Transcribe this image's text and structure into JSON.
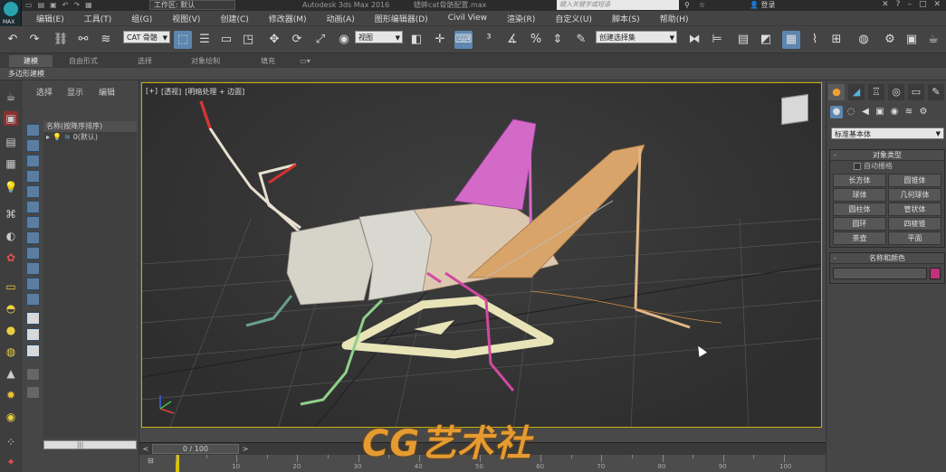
{
  "titlebar": {
    "logo_text": "MAX",
    "workspace": "工作区: 默认",
    "app_title": "Autodesk 3ds Max 2016",
    "doc_title": "蟋蟀cat骨骼配置.max",
    "search_placeholder": "键入关键字或短语",
    "login": "登录"
  },
  "menu": [
    "编辑(E)",
    "工具(T)",
    "组(G)",
    "视图(V)",
    "创建(C)",
    "修改器(M)",
    "动画(A)",
    "图形编辑器(D)",
    "Civil View",
    "渲染(R)",
    "自定义(U)",
    "脚本(S)",
    "帮助(H)"
  ],
  "toolbar": {
    "filter": "CAT 骨骼",
    "ref_coord": "视图",
    "named_selection": "创建选择集"
  },
  "ribbon": {
    "tabs": [
      "建模",
      "自由形式",
      "选择",
      "对象绘制",
      "填充"
    ],
    "subtab": "多边形建模"
  },
  "explorer": {
    "tabs": [
      "选择",
      "显示",
      "编辑"
    ],
    "column_header": "名称(按降序排序)",
    "rows": [
      {
        "label": "0(默认)"
      }
    ]
  },
  "viewport": {
    "label_parts": [
      "[+]",
      "[透视]",
      "[明暗处理 + 边面]"
    ]
  },
  "timeslider": {
    "frame": "0 / 100",
    "ticks": [
      "10",
      "20",
      "30",
      "40",
      "50",
      "60",
      "70",
      "80",
      "90",
      "100"
    ]
  },
  "command_panel": {
    "dropdown": "标准基本体",
    "object_type_title": "对象类型",
    "autogrid": "自动栅格",
    "buttons": [
      "长方体",
      "圆锥体",
      "球体",
      "几何球体",
      "圆柱体",
      "管状体",
      "圆环",
      "四棱锥",
      "茶壶",
      "平面"
    ],
    "name_color_title": "名称和颜色",
    "swatch_color": "#c0327a"
  },
  "watermark": "CG艺术社"
}
